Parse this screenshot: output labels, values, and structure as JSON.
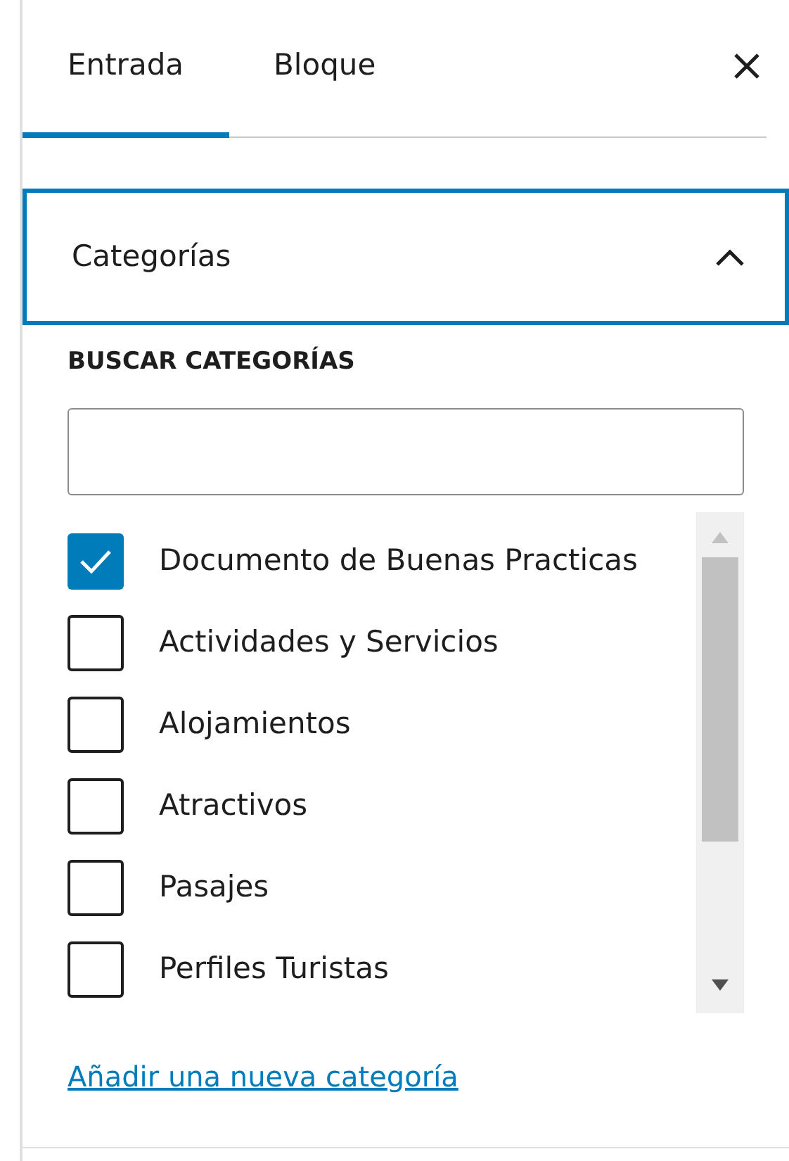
{
  "tabs": [
    {
      "label": "Entrada",
      "selected": true
    },
    {
      "label": "Bloque",
      "selected": false
    }
  ],
  "panel": {
    "title": "Categorías",
    "expanded": true
  },
  "search": {
    "label": "BUSCAR CATEGORÍAS"
  },
  "categories": [
    {
      "label": "Documento de Buenas Practicas",
      "checked": true
    },
    {
      "label": "Actividades y Servicios",
      "checked": false
    },
    {
      "label": "Alojamientos",
      "checked": false
    },
    {
      "label": "Atractivos",
      "checked": false
    },
    {
      "label": "Pasajes",
      "checked": false
    },
    {
      "label": "Perfiles Turistas",
      "checked": false
    }
  ],
  "add_link": "Añadir una nueva categoría"
}
